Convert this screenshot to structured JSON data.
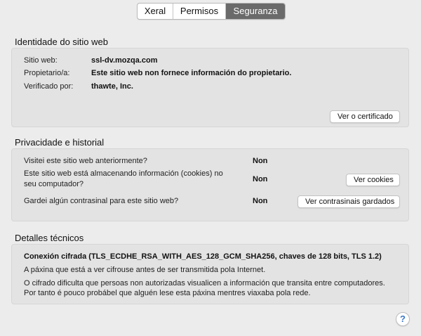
{
  "tabs": [
    {
      "label": "Xeral",
      "active": false
    },
    {
      "label": "Permisos",
      "active": false
    },
    {
      "label": "Seguranza",
      "active": true
    }
  ],
  "identity": {
    "title": "Identidade do sitio web",
    "website_label": "Sitio web:",
    "website_value": "ssl-dv.mozqa.com",
    "owner_label": "Propietario/a:",
    "owner_value": "Este sitio web non fornece información do propietario.",
    "verified_label": "Verificado por:",
    "verified_value": "thawte, Inc.",
    "view_cert_button": "Ver o certificado"
  },
  "privacy": {
    "title": "Privacidade e historial",
    "visited_question": "Visitei este sitio web anteriormente?",
    "visited_answer": "Non",
    "cookies_question_line1": "Este sitio web está almacenando información (cookies) no",
    "cookies_question_line2": "seu computador?",
    "cookies_answer": "Non",
    "cookies_button": "Ver cookies",
    "passwords_question": "Gardei algún contrasinal para este sitio web?",
    "passwords_answer": "Non",
    "passwords_button": "Ver contrasinais gardados"
  },
  "technical": {
    "title": "Detalles técnicos",
    "connection": "Conexión cifrada (TLS_ECDHE_RSA_WITH_AES_128_GCM_SHA256, chaves de 128 bits, TLS 1.2)",
    "line1": "A páxina que está a ver cifrouse antes de ser transmitida pola Internet.",
    "line2": "O cifrado dificulta que persoas non autorizadas visualicen a información que transita entre computadores.",
    "line3": "Por tanto é pouco probábel que alguén lese esta páxina mentres viaxaba pola rede."
  },
  "help": {
    "icon": "question-icon",
    "glyph": "?"
  },
  "colors": {
    "active_tab": "#6a6a6a",
    "panel": "#e3e3e3",
    "background": "#ececec"
  }
}
